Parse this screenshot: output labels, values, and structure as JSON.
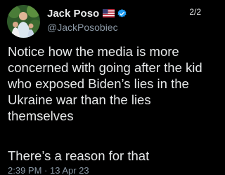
{
  "author": {
    "display_name": "Jack Poso",
    "handle": "@JackPosobiec",
    "avatar_icon": "profile-photo-icon",
    "flag_icon": "us-flag-icon",
    "verified_icon": "verified-badge-icon",
    "verified_color": "#1d9bf0"
  },
  "thread_position": "2/2",
  "tweet": {
    "body": "Notice how the media is more concerned with going after the kid who exposed Biden’s lies in the Ukraine war than the lies themselves",
    "closing": "There’s a reason for that",
    "timestamp": "2:39 PM · 13 Apr 23"
  },
  "colors": {
    "background": "#000000",
    "primary_text": "#e7e9ea",
    "secondary_text": "#8b98a5"
  }
}
